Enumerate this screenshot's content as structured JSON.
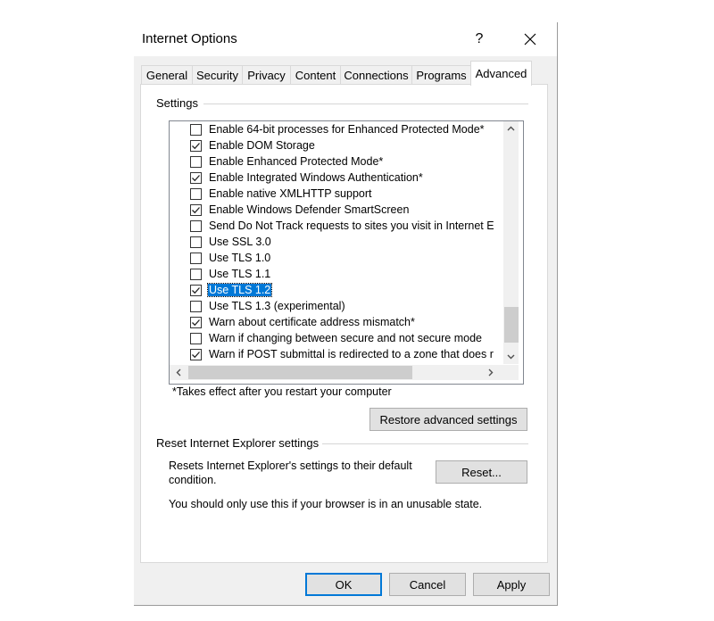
{
  "window": {
    "title": "Internet Options",
    "help_glyph": "?",
    "close_icon": "close-icon"
  },
  "tabs": [
    {
      "label": "General",
      "active": false
    },
    {
      "label": "Security",
      "active": false
    },
    {
      "label": "Privacy",
      "active": false
    },
    {
      "label": "Content",
      "active": false
    },
    {
      "label": "Connections",
      "active": false
    },
    {
      "label": "Programs",
      "active": false
    },
    {
      "label": "Advanced",
      "active": true
    }
  ],
  "settings": {
    "group_label": "Settings",
    "items": [
      {
        "label": "Enable 64-bit processes for Enhanced Protected Mode*",
        "checked": false,
        "selected": false
      },
      {
        "label": "Enable DOM Storage",
        "checked": true,
        "selected": false
      },
      {
        "label": "Enable Enhanced Protected Mode*",
        "checked": false,
        "selected": false
      },
      {
        "label": "Enable Integrated Windows Authentication*",
        "checked": true,
        "selected": false
      },
      {
        "label": "Enable native XMLHTTP support",
        "checked": false,
        "selected": false
      },
      {
        "label": "Enable Windows Defender SmartScreen",
        "checked": true,
        "selected": false
      },
      {
        "label": "Send Do Not Track requests to sites you visit in Internet E",
        "checked": false,
        "selected": false
      },
      {
        "label": "Use SSL 3.0",
        "checked": false,
        "selected": false
      },
      {
        "label": "Use TLS 1.0",
        "checked": false,
        "selected": false
      },
      {
        "label": "Use TLS 1.1",
        "checked": false,
        "selected": false
      },
      {
        "label": "Use TLS 1.2",
        "checked": true,
        "selected": true
      },
      {
        "label": "Use TLS 1.3 (experimental)",
        "checked": false,
        "selected": false
      },
      {
        "label": "Warn about certificate address mismatch*",
        "checked": true,
        "selected": false
      },
      {
        "label": "Warn if changing between secure and not secure mode",
        "checked": false,
        "selected": false
      },
      {
        "label": "Warn if POST submittal is redirected to a zone that does r",
        "checked": true,
        "selected": false
      }
    ],
    "note": "*Takes effect after you restart your computer",
    "restore_button": "Restore advanced settings"
  },
  "reset": {
    "group_label": "Reset Internet Explorer settings",
    "description": "Resets Internet Explorer's settings to their default condition.",
    "reset_button": "Reset...",
    "warning": "You should only use this if your browser is in an unusable state."
  },
  "footer": {
    "ok": "OK",
    "cancel": "Cancel",
    "apply": "Apply"
  }
}
